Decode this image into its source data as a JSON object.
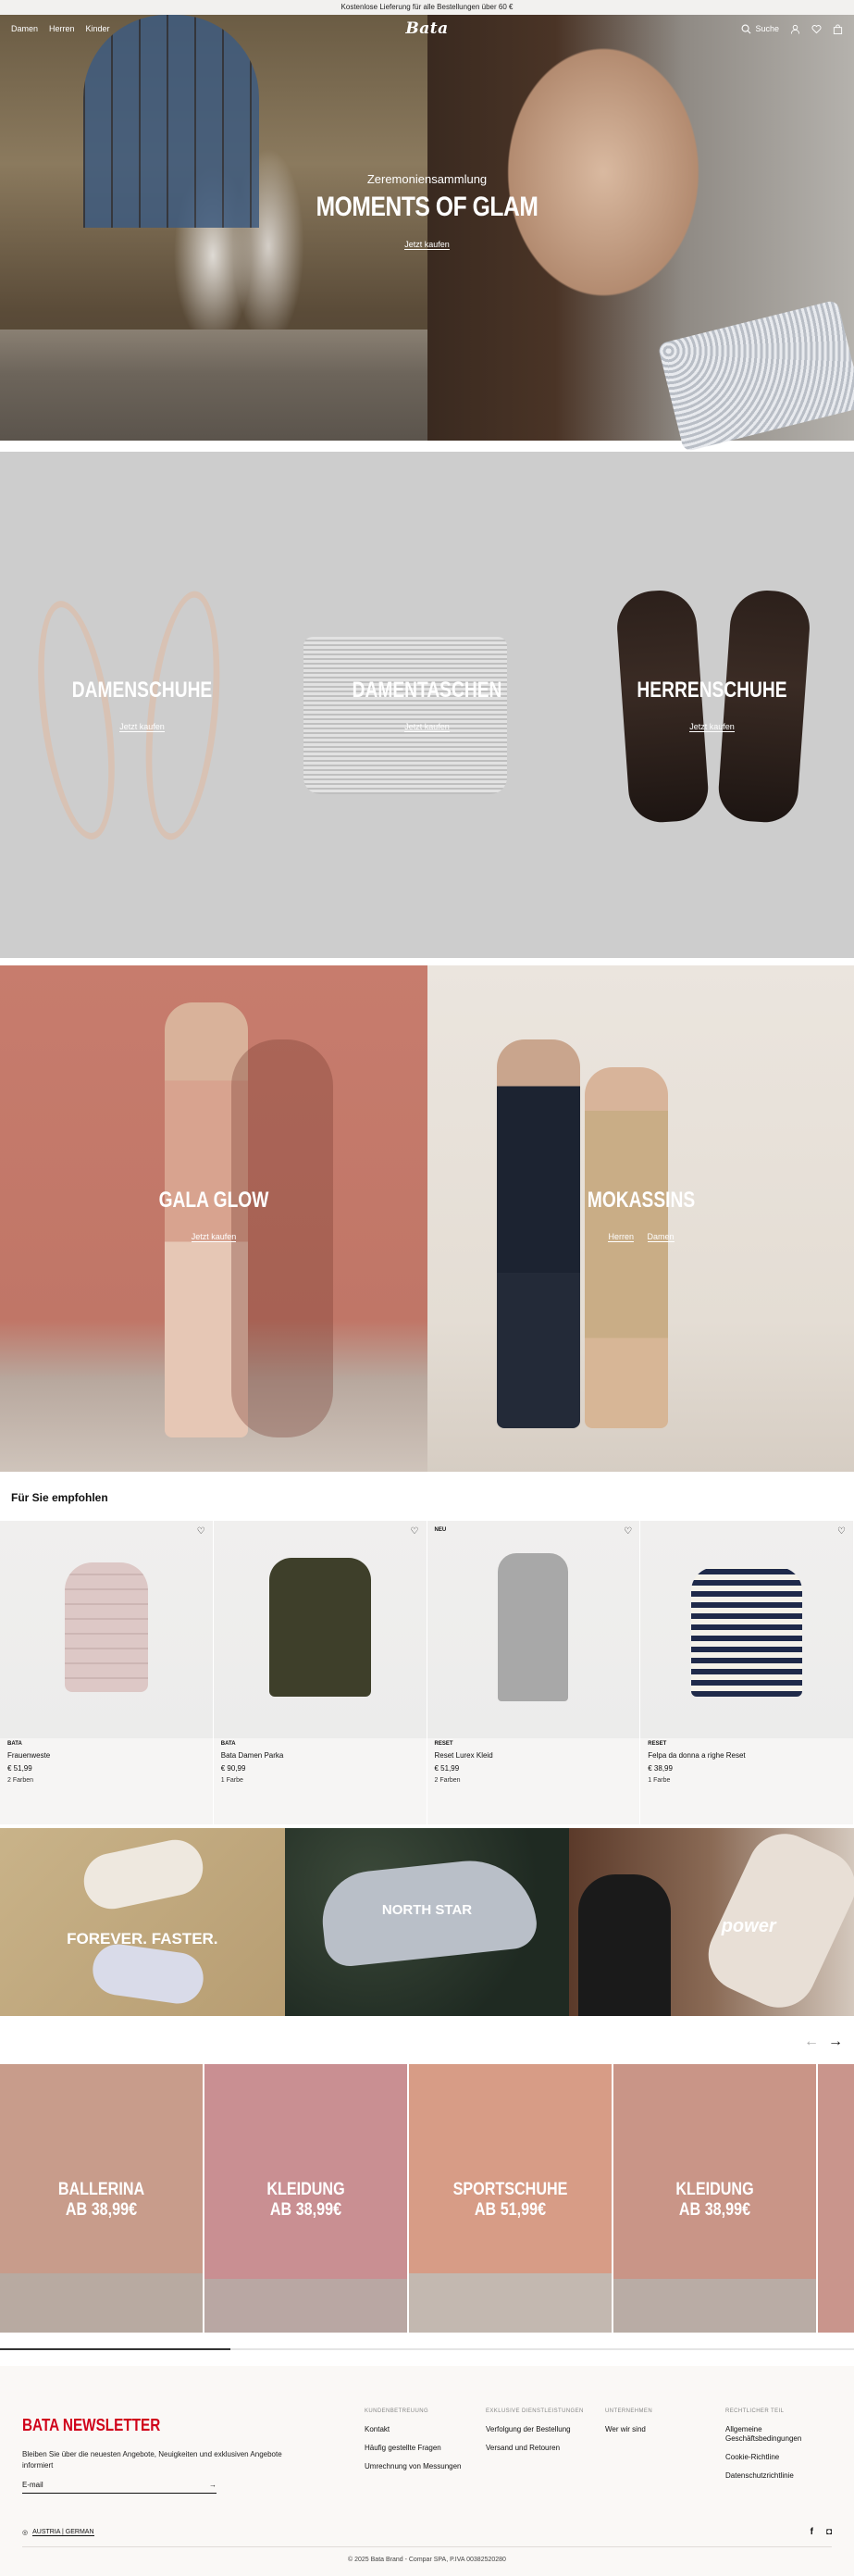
{
  "announcement": "Kostenlose Lieferung für alle Bestellungen über 60 €",
  "nav": {
    "links": [
      "Damen",
      "Herren",
      "Kinder"
    ],
    "logo": "Bata",
    "search_label": "Suche",
    "icons": [
      "search-icon",
      "user-icon",
      "heart-icon",
      "bag-icon"
    ]
  },
  "hero": {
    "subtitle": "Zeremoniensammlung",
    "title": "MOMENTS OF GLAM",
    "cta": "Jetzt kaufen"
  },
  "categories": [
    {
      "label": "DAMENSCHUHE",
      "cta": "Jetzt kaufen"
    },
    {
      "label": "DAMENTASCHEN",
      "cta": "Jetzt kaufen"
    },
    {
      "label": "HERRENSCHUHE",
      "cta": "Jetzt kaufen"
    }
  ],
  "editorial": [
    {
      "label": "GALA GLOW",
      "ctas": [
        "Jetzt kaufen"
      ]
    },
    {
      "label": "MOKASSINS",
      "ctas": [
        "Herren",
        "Damen"
      ]
    }
  ],
  "recommended": {
    "title": "Für Sie empfohlen",
    "products": [
      {
        "badge": "",
        "brand": "BATA",
        "name": "Frauenweste",
        "price": "€ 51,99",
        "colors": "2 Farben"
      },
      {
        "badge": "",
        "brand": "BATA",
        "name": "Bata Damen Parka",
        "price": "€ 90,99",
        "colors": "1 Farbe"
      },
      {
        "badge": "NEU",
        "brand": "RESET",
        "name": "Reset Lurex Kleid",
        "price": "€ 51,99",
        "colors": "2 Farben"
      },
      {
        "badge": "",
        "brand": "RESET",
        "name": "Felpa da donna a righe Reset",
        "price": "€ 38,99",
        "colors": "1 Farbe"
      }
    ]
  },
  "brands": [
    {
      "logo": "FOREVER. FASTER."
    },
    {
      "logo": "NORTH STAR"
    },
    {
      "logo": "power"
    }
  ],
  "promos": [
    {
      "line1": "BALLERINA",
      "line2": "AB 38,99€"
    },
    {
      "line1": "KLEIDUNG",
      "line2": "AB 38,99€"
    },
    {
      "line1": "SPORTSCHUHE",
      "line2": "AB 51,99€"
    },
    {
      "line1": "KLEIDUNG",
      "line2": "AB 38,99€"
    }
  ],
  "carousel_progress": 0.27,
  "footer": {
    "newsletter_title": "BATA NEWSLETTER",
    "newsletter_text": "Bleiben Sie über die neuesten Angebote, Neuigkeiten und exklusiven Angebote informiert",
    "email_placeholder": "E-mail",
    "columns": [
      {
        "heading": "KUNDENBETREUUNG",
        "links": [
          "Kontakt",
          "Häufig gestellte Fragen",
          "Umrechnung von Messungen"
        ]
      },
      {
        "heading": "EXKLUSIVE DIENSTLEISTUNGEN",
        "links": [
          "Verfolgung der Bestellung",
          "Versand und Retouren"
        ]
      },
      {
        "heading": "UNTERNEHMEN",
        "links": [
          "Wer wir sind"
        ]
      },
      {
        "heading": "RECHTLICHER TEIL",
        "links": [
          "Allgemeine Geschäftsbedingungen",
          "Cookie-Richtline",
          "Datenschutzrichtlinie"
        ]
      }
    ],
    "locale": "AUSTRIA | GERMAN",
    "social": [
      "facebook-icon",
      "instagram-icon"
    ],
    "copyright": "© 2025 Bata Brand - Compar SPA, P.IVA 00382520280"
  },
  "colors": {
    "accent": "#d0021b",
    "footer_bg": "#faf8f6",
    "category_bg": "#cdcdcd"
  }
}
